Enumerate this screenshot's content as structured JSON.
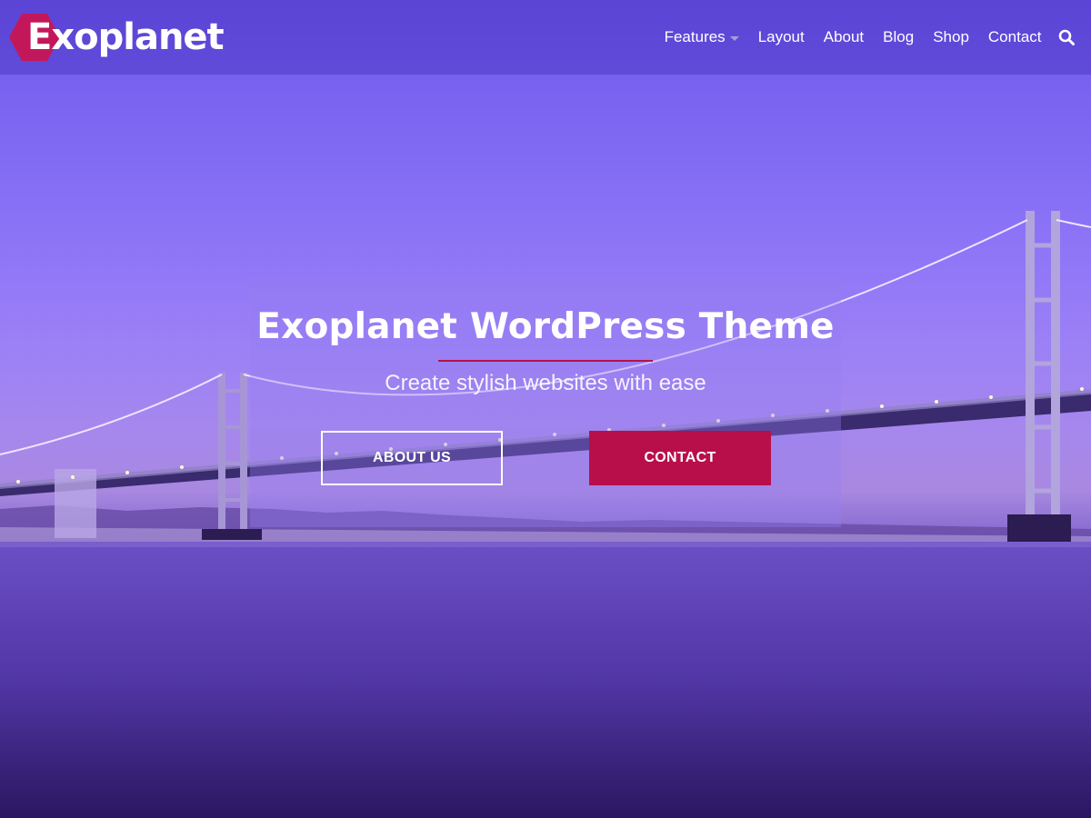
{
  "site": {
    "logo_text": "Exoplanet",
    "logo_color": "#c2185b"
  },
  "nav": {
    "items": [
      {
        "label": "Features",
        "has_dropdown": true
      },
      {
        "label": "Layout"
      },
      {
        "label": "About"
      },
      {
        "label": "Blog"
      },
      {
        "label": "Shop"
      },
      {
        "label": "Contact"
      }
    ],
    "search_icon": "search-icon"
  },
  "hero": {
    "title": "Exoplanet WordPress Theme",
    "subtitle": "Create stylish websites with ease",
    "buttons": {
      "primary_label": "ABOUT US",
      "secondary_label": "CONTACT"
    },
    "accent_color": "#b80f4a"
  }
}
